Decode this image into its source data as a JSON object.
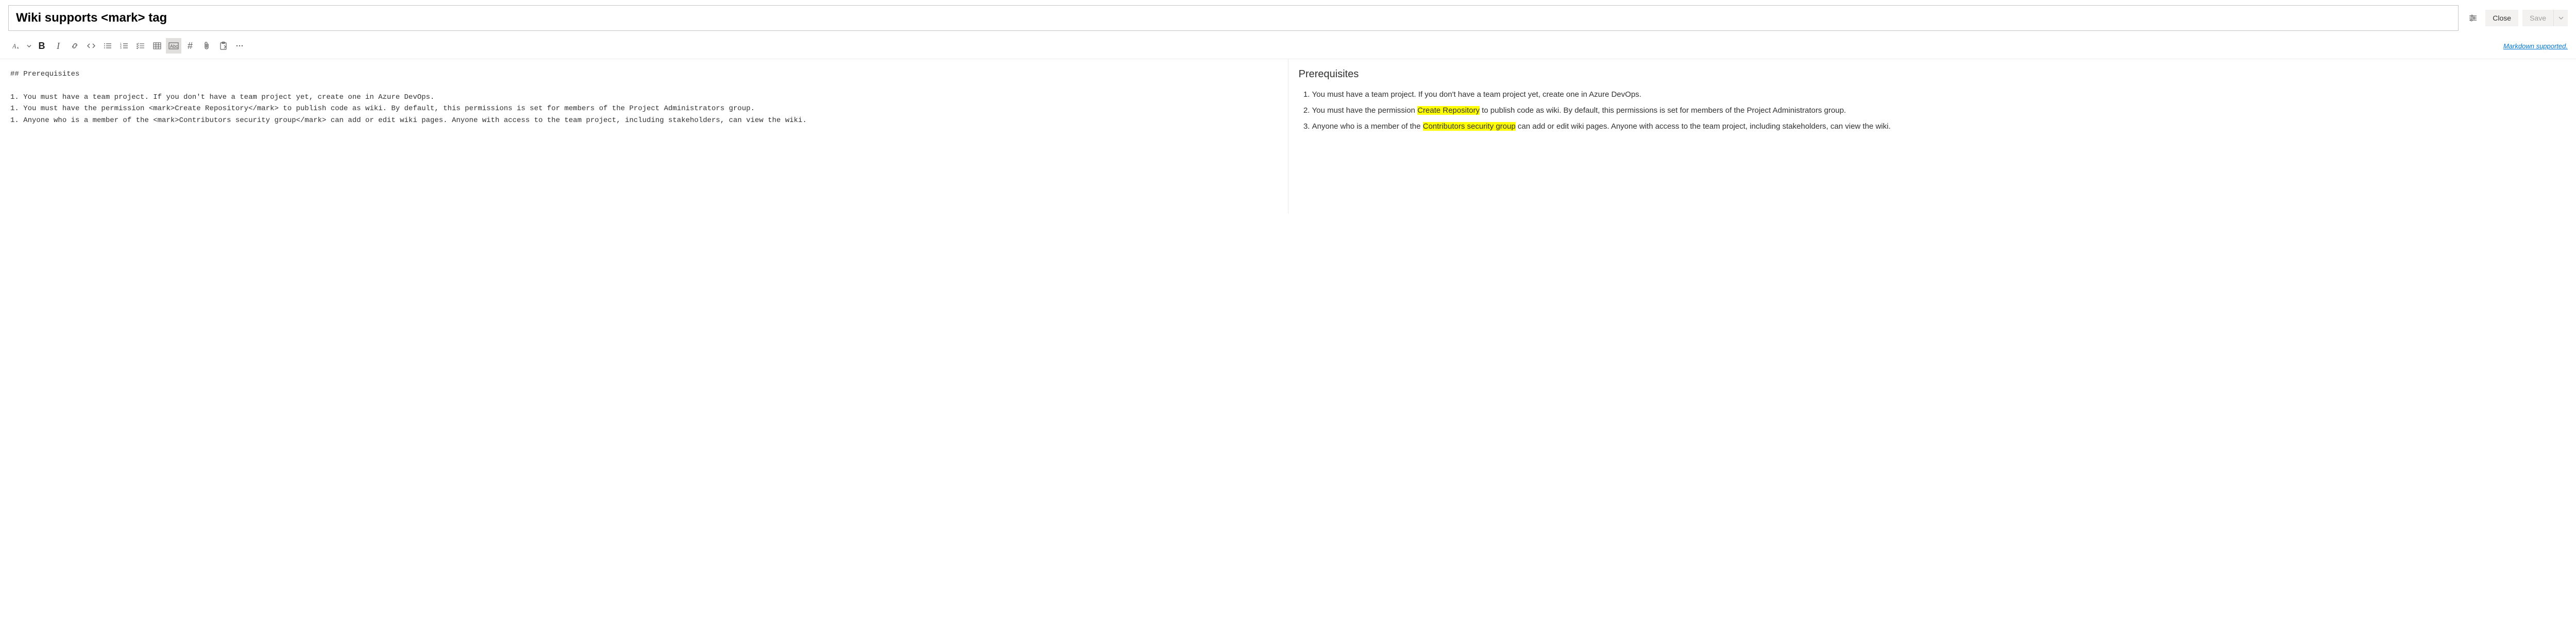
{
  "page": {
    "title": "Wiki supports <mark> tag"
  },
  "actions": {
    "close": "Close",
    "save": "Save",
    "markdown_supported": "Markdown supported."
  },
  "editor": {
    "raw": "## Prerequisites\n\n1. You must have a team project. If you don't have a team project yet, create one in Azure DevOps.\n1. You must have the permission <mark>Create Repository</mark> to publish code as wiki. By default, this permissions is set for members of the Project Administrators group.\n1. Anyone who is a member of the <mark>Contributors security group</mark> can add or edit wiki pages. Anyone with access to the team project, including stakeholders, can view the wiki."
  },
  "preview": {
    "heading": "Prerequisites",
    "items": [
      {
        "pre": "You must have a team project. If you don't have a team project yet, create one in Azure DevOps.",
        "mark": "",
        "post": ""
      },
      {
        "pre": "You must have the permission ",
        "mark": "Create Repository",
        "post": " to publish code as wiki. By default, this permissions is set for members of the Project Administrators group."
      },
      {
        "pre": "Anyone who is a member of the ",
        "mark": "Contributors security group",
        "post": " can add or edit wiki pages. Anyone with access to the team project, including stakeholders, can view the wiki."
      }
    ]
  }
}
